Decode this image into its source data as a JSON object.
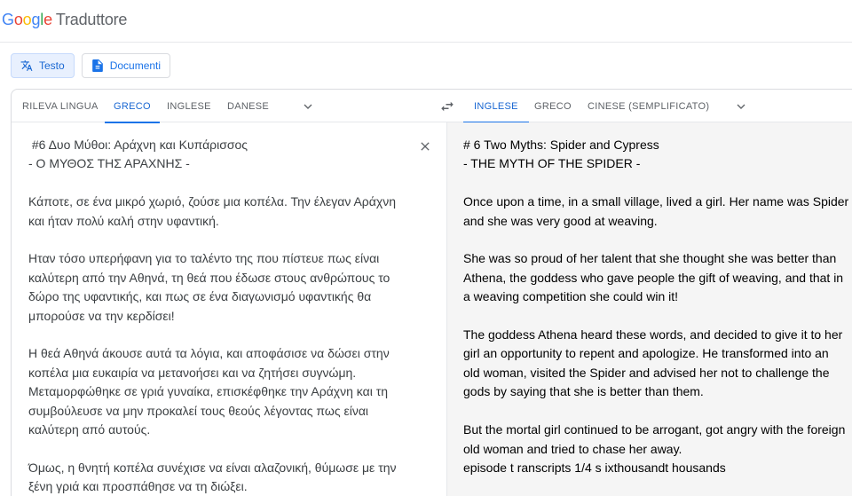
{
  "header": {
    "logo_letters": [
      {
        "char": "G",
        "color": "#4285F4"
      },
      {
        "char": "o",
        "color": "#EA4335"
      },
      {
        "char": "o",
        "color": "#FBBC05"
      },
      {
        "char": "g",
        "color": "#4285F4"
      },
      {
        "char": "l",
        "color": "#34A853"
      },
      {
        "char": "e",
        "color": "#EA4335"
      }
    ],
    "app_name": "Traduttore"
  },
  "modes": {
    "text_label": "Testo",
    "text_icon": "translate-icon",
    "docs_label": "Documenti",
    "docs_icon": "document-icon"
  },
  "source_langs": {
    "detect": "RILEVA LINGUA",
    "greek": "GRECO",
    "english": "INGLESE",
    "danish": "DANESE",
    "more_icon": "chevron-down-icon"
  },
  "swap_icon": "swap-arrows-icon",
  "target_langs": {
    "english": "INGLESE",
    "greek": "GRECO",
    "chinese": "CINESE (SEMPLIFICATO)",
    "more_icon": "chevron-down-icon"
  },
  "colors": {
    "accent": "#1a73e8",
    "active_tab_text": "#1967d2",
    "target_bg": "#f5f5f5"
  },
  "source_text": " #6 Δυο Μύθοι: Αράχνη και Κυπάρισσος\n- Ο ΜΥΘΟΣ ΤΗΣ ΑΡΑΧΝΗΣ -\n\nΚάποτε, σε ένα μικρό χωριό, ζούσε μια κοπέλα. Την έλεγαν Αράχνη\nκαι ήταν πολύ καλή στην υφαντική.\n\nΗταν τόσο υπερήφανη για το ταλέντο της που πίστευε πως είναι\nκαλύτερη από την Αθηνά, τη θεά που έδωσε στους ανθρώπους το\nδώρο της υφαντικής, και πως σε ένα διαγωνισμό υφαντικής θα\nμπορούσε να την κερδίσει!\n\nΗ θεά Αθηνά άκουσε αυτά τα λόγια, και αποφάσισε να δώσει στην\nκοπέλα μια ευκαιρία να μετανοήσει και να ζητήσει συγνώμη.\nΜεταμορφώθηκε σε γριά γυναίκα, επισκέφθηκε την Αράχνη και τη\nσυμβούλευσε να μην προκαλεί τους θεούς λέγοντας πως είναι\nκαλύτερη από αυτούς.\n\nΌμως, η θνητή κοπέλα συνέχισε να είναι αλαζονική, θύμωσε με την\nξένη γριά και προσπάθησε να τη διώξει.",
  "clear_icon": "close-icon",
  "translated_text": "# 6 Two Myths: Spider and Cypress\n- THE MYTH OF THE SPIDER -\n\nOnce upon a time, in a small village, lived a girl. Her name was Spider\nand she was very good at weaving.\n\nShe was so proud of her talent that she thought she was better than\nAthena, the goddess who gave people the gift of weaving, and that in\na weaving competition she could win it!\n\nThe goddess Athena heard these words, and decided to give it to her\ngirl an opportunity to repent and apologize. He transformed into an\nold woman, visited the Spider and advised her not to challenge the\ngods by saying that she is better than them.\n\nBut the mortal girl continued to be arrogant, got angry with the foreign\nold woman and tried to chase her away.\nepisode t ranscripts 1/4 s ixthousandt housands"
}
